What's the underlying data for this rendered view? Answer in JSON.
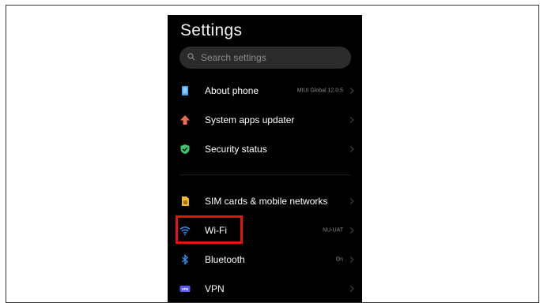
{
  "header": {
    "title": "Settings"
  },
  "search": {
    "placeholder": "Search settings"
  },
  "items": [
    {
      "label": "About phone",
      "value": "MIUI Global 12.0.5",
      "icon": "phone-info-icon"
    },
    {
      "label": "System apps updater",
      "value": "",
      "icon": "arrow-up-icon"
    },
    {
      "label": "Security status",
      "value": "",
      "icon": "shield-check-icon"
    },
    {
      "label": "SIM cards & mobile networks",
      "value": "",
      "icon": "sim-card-icon"
    },
    {
      "label": "Wi-Fi",
      "value": "NU-UAT",
      "icon": "wifi-icon"
    },
    {
      "label": "Bluetooth",
      "value": "On",
      "icon": "bluetooth-icon"
    },
    {
      "label": "VPN",
      "value": "",
      "icon": "vpn-icon"
    }
  ],
  "vpn_icon_text": "VPN",
  "colors": {
    "background": "#000000",
    "highlight": "#e8120c",
    "about_icon": "#4aa3f0",
    "updater_icon": "#f26b4a",
    "security_icon": "#3ec46d",
    "sim_icon": "#f5b82e",
    "wifi_icon": "#2f8ff0",
    "bluetooth_icon": "#2f8ff0",
    "vpn_icon": "#5a5af0"
  }
}
